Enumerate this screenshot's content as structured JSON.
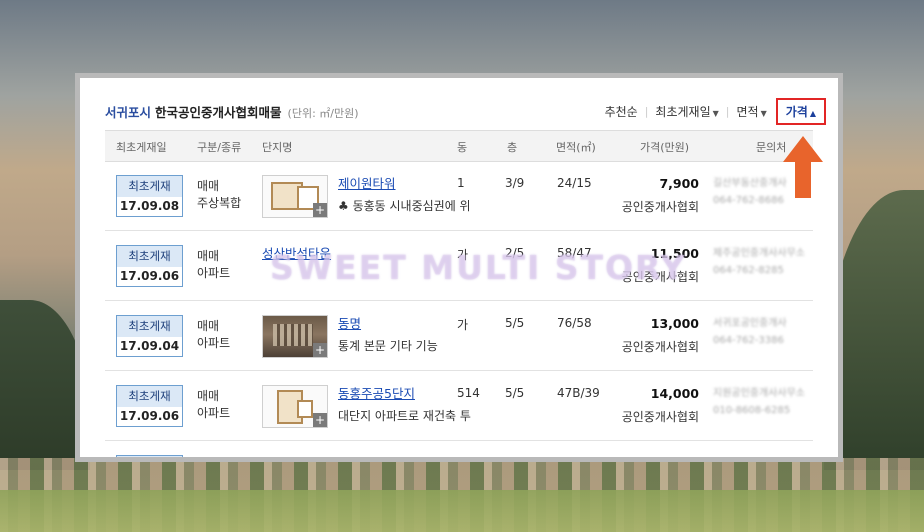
{
  "header": {
    "region": "서귀포시",
    "association": "한국공인중개사협회매물",
    "unit": "(단위: ㎡/만원)",
    "sorts": [
      {
        "label": "추천순",
        "caret": ""
      },
      {
        "label": "최초게재일",
        "caret": "▼"
      },
      {
        "label": "면적",
        "caret": "▼"
      }
    ],
    "active_sort": {
      "label": "가격",
      "caret": "▲"
    }
  },
  "columns": [
    "최초게재일",
    "구분/종류",
    "단지명",
    "동",
    "층",
    "면적(㎡)",
    "가격(만원)",
    "문의처"
  ],
  "listings": [
    {
      "badge": "최초게재",
      "date": "17.09.08",
      "deal": "매매",
      "type": "주상복합",
      "name": "제이원타워",
      "desc": "♣ 동홍동 시내중심권에 위",
      "dong": "1",
      "floor": "3/9",
      "area": "24/15",
      "price": "7,900",
      "agent": "공인중개사협회",
      "contact1": "길산부동산중개사",
      "contact2": "064-762-8686"
    },
    {
      "badge": "최초게재",
      "date": "17.09.06",
      "deal": "매매",
      "type": "아파트",
      "name": "성산반석타운",
      "desc": "",
      "dong": "가",
      "floor": "2/5",
      "area": "58/47",
      "price": "11,500",
      "agent": "공인중개사협회",
      "contact1": "제주공인중개사사무소",
      "contact2": "064-762-8285"
    },
    {
      "badge": "최초게재",
      "date": "17.09.04",
      "deal": "매매",
      "type": "아파트",
      "name": "동명",
      "desc": "통계 본문 기타 기능",
      "dong": "가",
      "floor": "5/5",
      "area": "76/58",
      "price": "13,000",
      "agent": "공인중개사협회",
      "contact1": "서귀포공인중개사",
      "contact2": "064-762-3386"
    },
    {
      "badge": "최초게재",
      "date": "17.09.06",
      "deal": "매매",
      "type": "아파트",
      "name": "동홍주공5단지",
      "desc": "대단지 아파트로 재건축 투",
      "dong": "514",
      "floor": "5/5",
      "area": "47B/39",
      "price": "14,000",
      "agent": "공인중개사협회",
      "contact1": "지원공인중개사사무소",
      "contact2": "010-8608-6285"
    }
  ],
  "watermark": "SWEET MULTI STORY",
  "colors": {
    "accent": "#1b3f9c",
    "highlight": "#e22525",
    "arrow": "#e8642c",
    "badge_border": "#6d9fd0"
  }
}
